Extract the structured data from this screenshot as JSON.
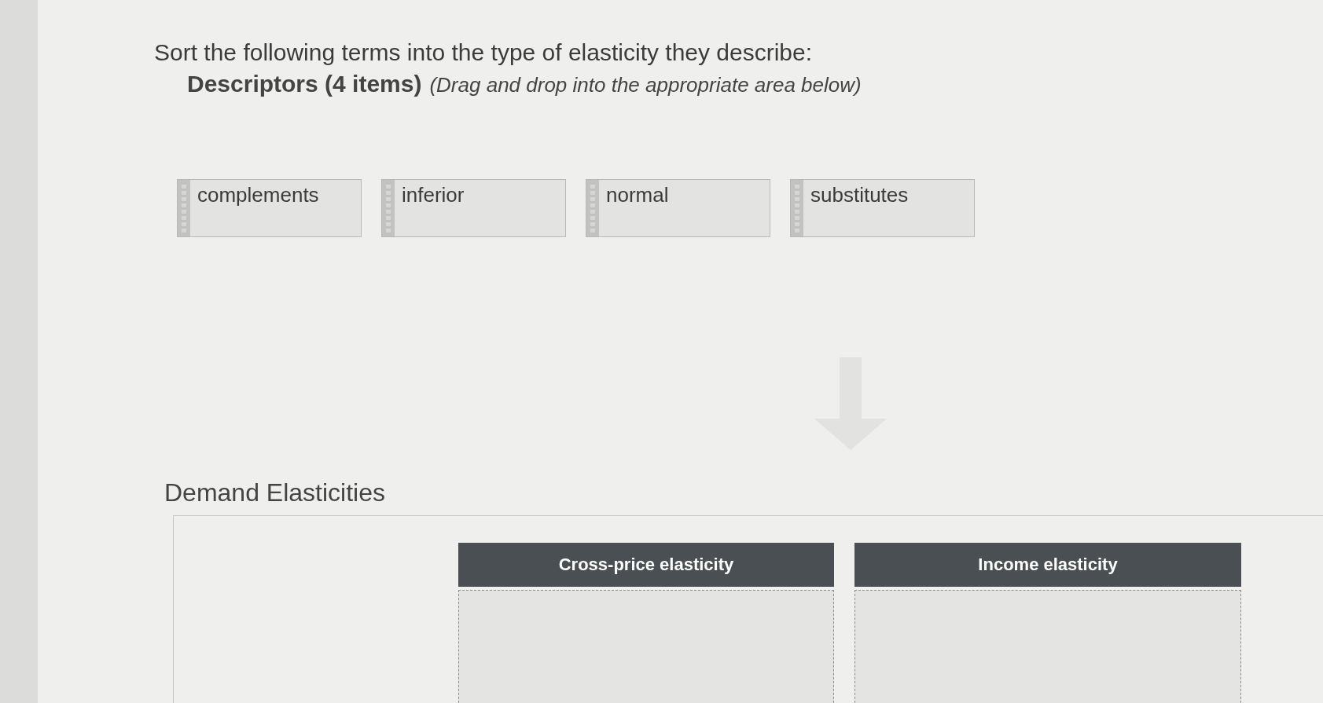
{
  "question": {
    "prompt": "Sort the following terms into the type of elasticity they describe:",
    "pool_title": "Descriptors (4 items)",
    "pool_hint": "(Drag and drop into the appropriate area below)"
  },
  "descriptors": [
    {
      "label": "complements"
    },
    {
      "label": "inferior"
    },
    {
      "label": "normal"
    },
    {
      "label": "substitutes"
    }
  ],
  "drop_area": {
    "title": "Demand Elasticities",
    "categories": [
      {
        "label": "Cross-price elasticity"
      },
      {
        "label": "Income elasticity"
      }
    ]
  }
}
